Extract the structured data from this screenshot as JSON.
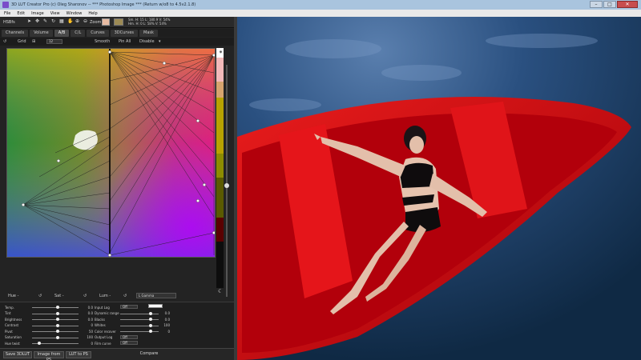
{
  "window": {
    "title": "3D LUT Creator Pro (c) Oleg Sharonov -- *** Photoshop Image *** (Return w/o8 to 4.5v2.1.8)",
    "buttons": [
      "–",
      "□",
      "✕"
    ]
  },
  "menu": [
    "File",
    "Edit",
    "Image",
    "View",
    "Window",
    "Help"
  ],
  "toolbar": {
    "preset": "HSBfs",
    "zoom": "Zoom",
    "readout_line1": "Sm. H: 15   L: 180.9   V: 54%",
    "readout_line2": "Hm. H: 0    L: 58%      V: 54%"
  },
  "tabs": [
    "Channels",
    "Volume",
    "A/B",
    "C/L",
    "Curves",
    "3DCurves",
    "Mask"
  ],
  "active_tab": "A/B",
  "subtoolbar": {
    "grid_label": "Grid",
    "grid_value": "12",
    "smooth": "Smooth",
    "pin_all": "Pin All",
    "disable": "Disable"
  },
  "mid_controls": {
    "hue": "Hue -",
    "sat": "Sat -",
    "lum": "Lum -",
    "gamma": "L Gamma"
  },
  "left_params": [
    {
      "label": "Temp.",
      "value": "0.0",
      "pos": 0.55
    },
    {
      "label": "Tint",
      "value": "0.0",
      "pos": 0.55
    },
    {
      "label": "Brightness",
      "value": "0.0",
      "pos": 0.55
    },
    {
      "label": "Contrast",
      "value": "0",
      "pos": 0.55
    },
    {
      "label": "Pivot",
      "value": "50",
      "pos": 0.55
    },
    {
      "label": "Saturation",
      "value": "100",
      "pos": 0.55
    },
    {
      "label": "Hue twist",
      "value": "0",
      "pos": 0.15
    }
  ],
  "right_params": [
    {
      "label": "Input Log",
      "value": "Off"
    },
    {
      "label": "Dynamic range",
      "value": "0.0"
    },
    {
      "label": "Blacks",
      "value": "0.0"
    },
    {
      "label": "Whites",
      "value": "100"
    },
    {
      "label": "Color recover",
      "value": "0"
    },
    {
      "label": "Output Log",
      "value": "Off"
    },
    {
      "label": "Film curve",
      "value": "Off"
    }
  ],
  "bottom": {
    "save": "Save 3DLUT",
    "image_from_ps": "Image from PS",
    "lut_to_ps": "LUT to PS",
    "compare": "Compare"
  },
  "colors": {
    "boat_red": "#d40a12",
    "water_blue": "#1b3f66"
  }
}
